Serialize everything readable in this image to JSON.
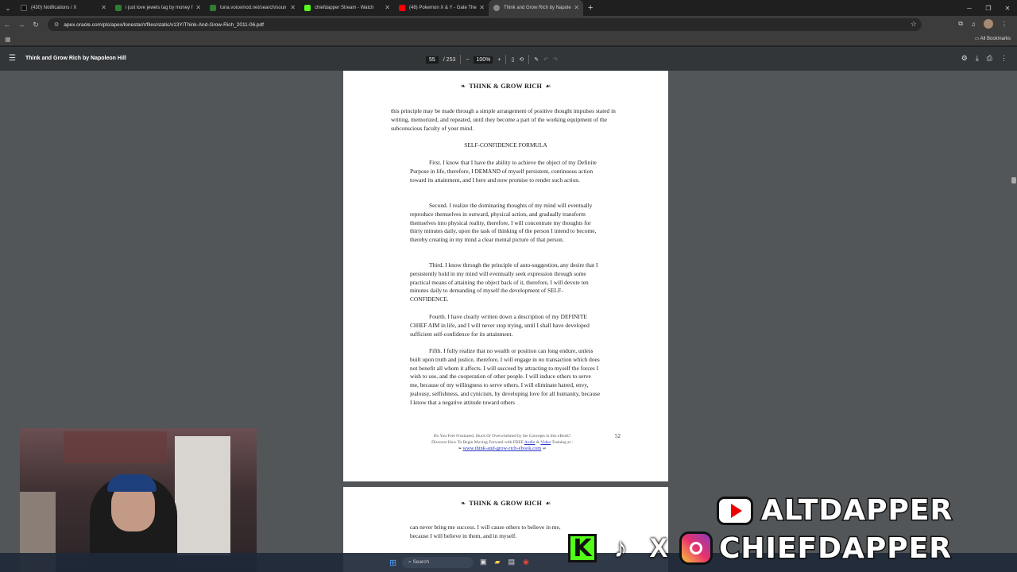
{
  "browser": {
    "tabs": [
      {
        "label": "(430) Notifications / X",
        "color": "#111111"
      },
      {
        "label": "i just love jewels tag by money f",
        "color": "#2e7d32"
      },
      {
        "label": "tuna.voicemod.net/search/soun",
        "color": "#2e7d32"
      },
      {
        "label": "chiefdapper Stream - Watch",
        "color": "#53fc18"
      },
      {
        "label": "(48) Pokemon X & Y - Gate The",
        "color": "#ff0000"
      },
      {
        "label": "Think and Grow Rich by Napole",
        "color": "#888888"
      }
    ],
    "url": "apex.oracle.com/pls/apex/lonestar/r/files/static/v13Y/Think-And-Grow-Rich_2011-06.pdf",
    "all_bookmarks": "All Bookmarks"
  },
  "pdf_toolbar": {
    "title": "Think and Grow Rich by Napoleon Hill",
    "page_current": "55",
    "page_total": "/ 253",
    "zoom": "100%"
  },
  "page1": {
    "header": "THINK & GROW RICH",
    "intro": "this principle may be made through a simple arrangement of positive thought impulses stated in writing, memorized, and repeated, until they become a part of the working equipment of the subconscious faculty of your mind.",
    "formula_title": "SELF-CONFIDENCE FORMULA",
    "paragraphs": [
      "First. I know that I have the ability to achieve the object of my Definite Purpose in life, therefore, I DEMAND of myself persistent, continuous action toward its attainment, and I here and now promise to render such action.",
      "Second. I realize the dominating thoughts of my mind will eventually reproduce themselves in outward, physical action, and gradually transform themselves into physical reality, therefore, I will concentrate my thoughts for thirty minutes daily, upon the task of thinking of the person I intend to become, thereby creating in my mind a clear mental picture of that person.",
      "Third. I know through the principle of auto-suggestion, any desire that I persistently hold in my mind will eventually seek expression through some practical means of attaining the object back of it, therefore, I will devote ten minutes daily to demanding of myself the development of SELF-CONFIDENCE.",
      "Fourth. I have clearly written down a description of my DEFINITE CHIEF AIM in life, and I will never stop trying, until I shall have developed sufficient self-confidence for its attainment.",
      "Fifth. I fully realize that no wealth or position can long endure, unless built upon truth and justice, therefore, I will engage in no transaction which does not benefit all whom it affects. I will succeed by attracting to myself the forces I wish to use, and the cooperation of other people. I will induce others to serve me, because of my willingness to serve others. I will eliminate hatred, envy, jealousy, selfishness, and cynicism, by developing love for all humanity, because I know that a negative attitude toward others"
    ],
    "footer_line1": "Do You Feel Frustrated, Stuck Or Overwhelmed by the Concepts in this eBook?",
    "footer_line2_a": "Discover How To Begin Moving Forward with FREE",
    "footer_audio": "Audio",
    "footer_amp": "&",
    "footer_video": "Video",
    "footer_line2_b": "Training at :",
    "footer_url": "www.think-and-grow-rich-ebook.com",
    "page_number": "52"
  },
  "page2": {
    "header": "THINK & GROW RICH",
    "line1": "can never bring me success. I will cause others to believe in me,",
    "line2": "because I will believe in them, and in myself."
  },
  "overlay": {
    "youtube_handle": "ALTDAPPER",
    "social_handle": "CHIEFDAPPER"
  },
  "taskbar": {
    "search_label": "Search"
  }
}
